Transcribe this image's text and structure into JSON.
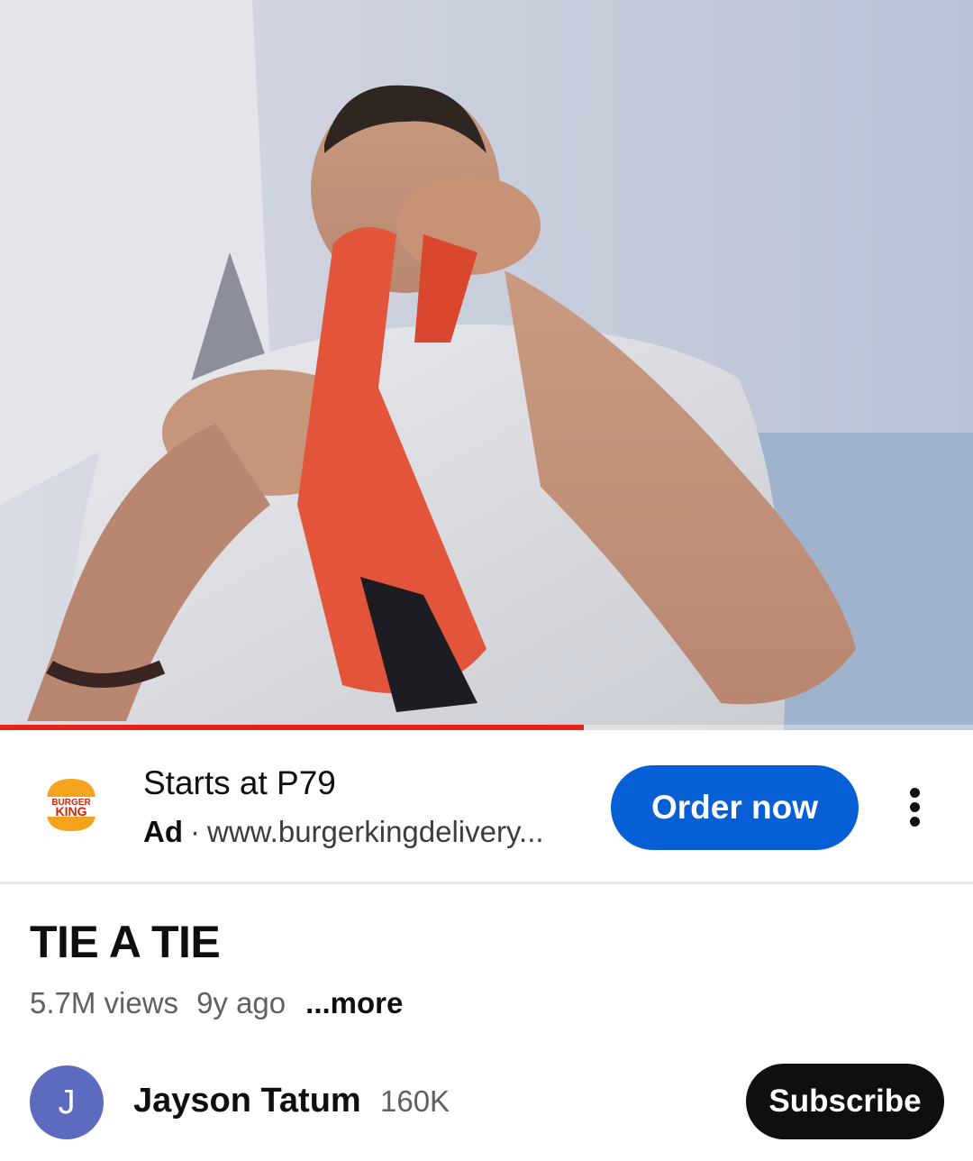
{
  "player": {
    "progress_fraction": 0.6,
    "accent_color": "#e62117"
  },
  "ad": {
    "advertiser_logo": "burger-king-logo",
    "logo_text_top": "BURGER",
    "logo_text_bottom": "KING",
    "headline": "Starts at P79",
    "badge": "Ad",
    "separator": "·",
    "url": "www.burgerkingdelivery...",
    "cta_label": "Order now",
    "cta_color": "#065fd4",
    "more_icon": "more-vert-icon"
  },
  "video": {
    "title": "TIE A TIE",
    "views": "5.7M views",
    "age": "9y ago",
    "more_label": "...more"
  },
  "channel": {
    "avatar_letter": "J",
    "avatar_color": "#5c6bc0",
    "name": "Jayson Tatum",
    "subscribers": "160K",
    "subscribe_label": "Subscribe"
  }
}
